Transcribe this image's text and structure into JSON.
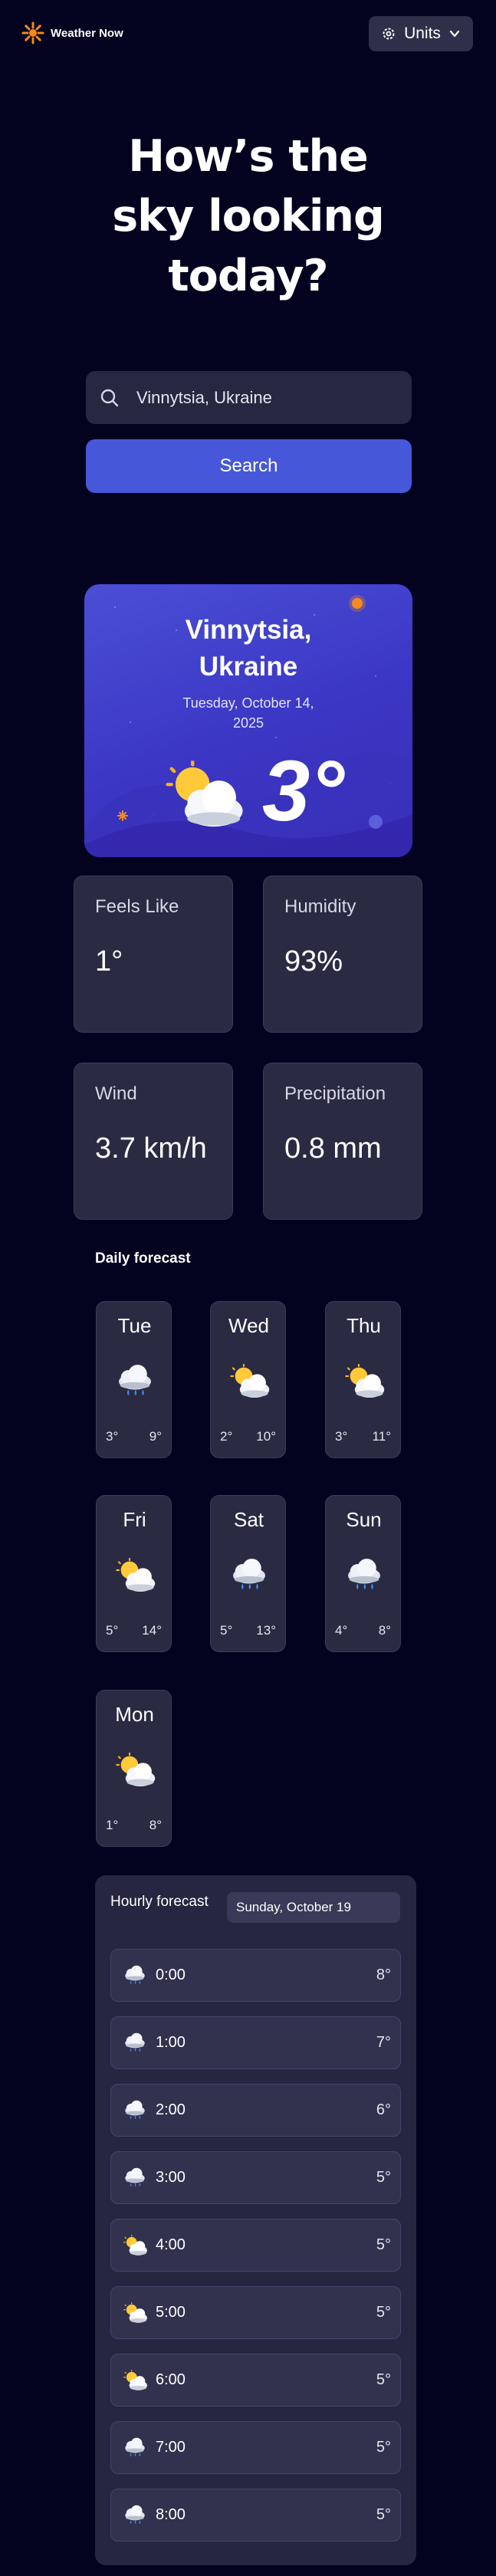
{
  "header": {
    "app_name": "Weather Now",
    "units_label": "Units"
  },
  "hero": {
    "line1": "How’s the",
    "line2": "sky looking",
    "line3": "today?"
  },
  "search": {
    "value": "Vinnytsia,  Ukraine",
    "button_label": "Search"
  },
  "current": {
    "city_line1": "Vinnytsia,",
    "city_line2": "Ukraine",
    "date_line1": "Tuesday, October 14,",
    "date_line2": "2025",
    "temperature": "3°",
    "icon": "partly-cloudy-icon"
  },
  "stats": [
    {
      "label": "Feels Like",
      "value": "1°"
    },
    {
      "label": "Humidity",
      "value": "93%"
    },
    {
      "label": "Wind",
      "value": "3.7 km/h"
    },
    {
      "label": "Precipitation",
      "value": "0.8 mm"
    }
  ],
  "daily": {
    "title": "Daily forecast",
    "days": [
      {
        "name": "Tue",
        "low": "3°",
        "high": "9°",
        "icon": "rain-cloud-icon"
      },
      {
        "name": "Wed",
        "low": "2°",
        "high": "10°",
        "icon": "partly-cloudy-icon"
      },
      {
        "name": "Thu",
        "low": "3°",
        "high": "11°",
        "icon": "partly-cloudy-icon"
      },
      {
        "name": "Fri",
        "low": "5°",
        "high": "14°",
        "icon": "partly-cloudy-icon"
      },
      {
        "name": "Sat",
        "low": "5°",
        "high": "13°",
        "icon": "rain-cloud-icon"
      },
      {
        "name": "Sun",
        "low": "4°",
        "high": "8°",
        "icon": "rain-cloud-icon"
      },
      {
        "name": "Mon",
        "low": "1°",
        "high": "8°",
        "icon": "partly-cloudy-icon"
      }
    ]
  },
  "hourly": {
    "title": "Hourly forecast",
    "selected_day": "Sunday, October 19",
    "hours": [
      {
        "time": "0:00",
        "temp": "8°",
        "icon": "rain-cloud-icon"
      },
      {
        "time": "1:00",
        "temp": "7°",
        "icon": "rain-cloud-icon"
      },
      {
        "time": "2:00",
        "temp": "6°",
        "icon": "rain-cloud-icon"
      },
      {
        "time": "3:00",
        "temp": "5°",
        "icon": "rain-cloud-icon"
      },
      {
        "time": "4:00",
        "temp": "5°",
        "icon": "partly-cloudy-icon"
      },
      {
        "time": "5:00",
        "temp": "5°",
        "icon": "partly-cloudy-icon"
      },
      {
        "time": "6:00",
        "temp": "5°",
        "icon": "partly-cloudy-icon"
      },
      {
        "time": "7:00",
        "temp": "5°",
        "icon": "rain-cloud-icon"
      },
      {
        "time": "8:00",
        "temp": "5°",
        "icon": "rain-cloud-icon"
      }
    ]
  },
  "colors": {
    "background": "#03021f",
    "card": "#2a2a43",
    "accent": "#4658d9",
    "logo_orange": "#f58a1f"
  }
}
